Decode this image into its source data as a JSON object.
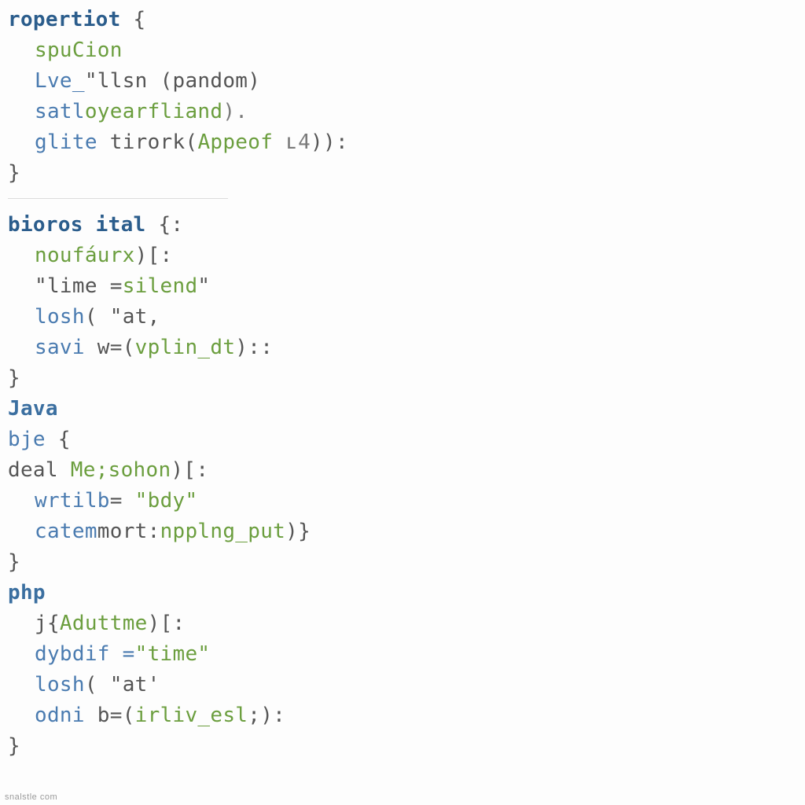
{
  "block1": {
    "head": {
      "t1": "ropertiot",
      "brace": " {"
    },
    "l1": {
      "t1": "spuCion"
    },
    "l2": {
      "t1": "Lve_",
      "t2": "\"llsn ",
      "t3": "(pandom)"
    },
    "l3": {
      "t1": "satl",
      "t2": "oyearfliand",
      "t3": ")."
    },
    "l4": {
      "t1": "glite ",
      "t2": "tirork",
      "t3": "(",
      "t4": "Appeof",
      "t5": " ʟ4",
      "t6": ")):"
    },
    "close": "}"
  },
  "block2": {
    "head": {
      "t1": "bioros ital",
      "brace": " {:"
    },
    "l1": {
      "t1": "noufáurx",
      "t2": ")[:"
    },
    "l2": {
      "t1": "\"lime =",
      "t2": "silend",
      "t3": "\""
    },
    "l3": {
      "t1": "losh",
      "t2": "( \"at,"
    },
    "l4": {
      "t1": "savi ",
      "t2": "w=(",
      "t3": "vplin_dt",
      "t4": ")::"
    },
    "close": "}"
  },
  "block3": {
    "head": "Java",
    "l1": {
      "t1": "bje",
      "brace": " {"
    },
    "l2": {
      "t1": "deal ",
      "t2": "Me;sohon",
      "t3": ")[:"
    },
    "l3": {
      "t1": "wrtilb",
      "t2": "= ",
      "t3": "\"bdy\""
    },
    "l4": {
      "t1": "catem",
      "t2": "mort:",
      "t3": "npplng_put",
      "t4": ")}"
    },
    "close": "}"
  },
  "block4": {
    "head": "php",
    "l1": {
      "t1": "j{",
      "t2": "Aduttme",
      "t3": ")[:"
    },
    "l2": {
      "t1": "dybdif =",
      "t2": "\"time\""
    },
    "l3": {
      "t1": "losh",
      "t2": "( \"at'"
    },
    "l4": {
      "t1": "odni ",
      "t2": "b=(",
      "t3": "irliv_esl",
      "t4": ";):"
    },
    "close": "}"
  },
  "watermark": "snalstle com"
}
